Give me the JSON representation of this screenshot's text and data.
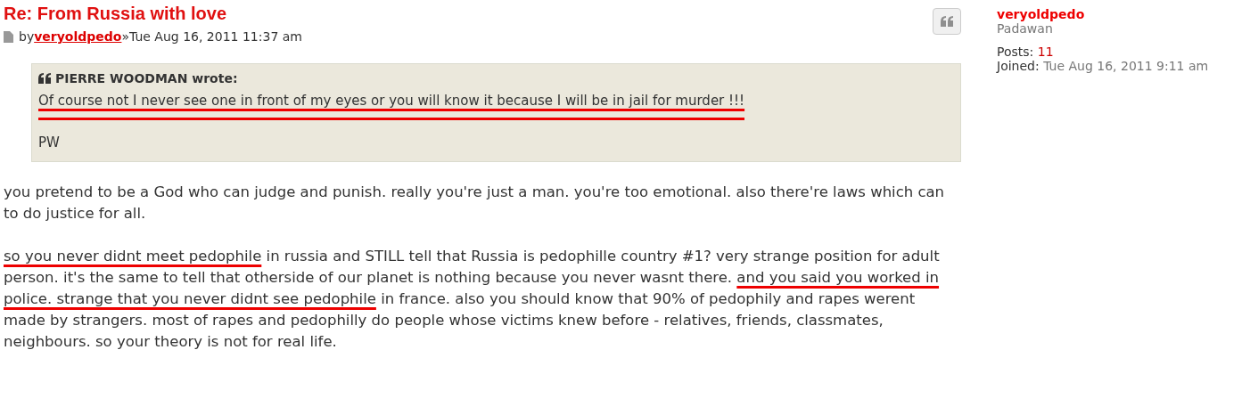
{
  "post": {
    "title": "Re: From Russia with love",
    "by": "by",
    "author": "veryoldpedo",
    "separator": "»",
    "date": "Tue Aug 16, 2011 11:37 am",
    "quote": {
      "author": "PIERRE WOODMAN wrote:",
      "lines": [
        {
          "text": "Of course not I never see one in front of my eyes or you will know it because I will be in jail for murder !!!",
          "underlined": true
        },
        {
          "text": "PW",
          "underlined": false
        }
      ]
    },
    "paragraphs": [
      [
        {
          "text": "you pretend to be a God who can judge and punish. really you're just a man. you're too emotional. also there're laws which can to do justice for all.",
          "underlined": false
        }
      ],
      [
        {
          "text": "so you never didnt meet pedophile",
          "underlined": true
        },
        {
          "text": " in russia and STILL tell that Russia is pedophille country #1? very strange position for adult person. it's the same to tell that otherside of our planet is nothing because you never wasnt there. ",
          "underlined": false
        },
        {
          "text": "and you said you worked in police. strange that you never didnt see pedophile",
          "underlined": true
        },
        {
          "text": " in france. also you should know that 90% of pedophily and rapes werent made by strangers. most of rapes and pedophilly do people whose victims knew before - relatives, friends, classmates, neighbours. so your theory is not for real life.",
          "underlined": false
        }
      ]
    ]
  },
  "profile": {
    "name": "veryoldpedo",
    "rank": "Padawan",
    "posts_label": "Posts:",
    "posts": "11",
    "joined_label": "Joined:",
    "joined": "Tue Aug 16, 2011 9:11 am"
  }
}
